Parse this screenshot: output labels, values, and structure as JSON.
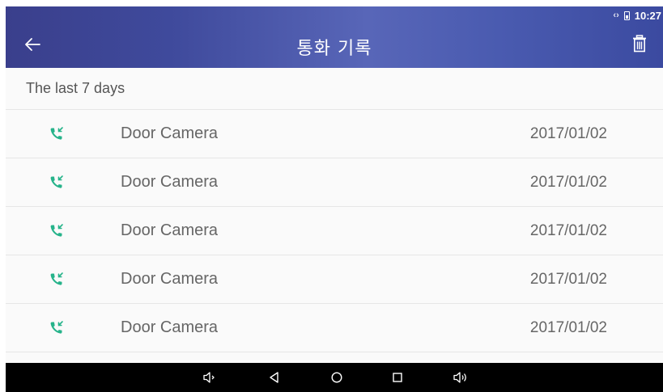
{
  "status_bar": {
    "time": "10:27",
    "sync_icon": "sync-arrows-icon",
    "battery_icon": "battery-icon"
  },
  "app_bar": {
    "title": "통화 기록",
    "back_icon": "arrow-left-icon",
    "delete_icon": "trash-icon"
  },
  "section": {
    "header": "The last 7 days"
  },
  "call_log": [
    {
      "icon": "incoming-call-icon",
      "name": "Door Camera",
      "date": "2017/01/02"
    },
    {
      "icon": "incoming-call-icon",
      "name": "Door Camera",
      "date": "2017/01/02"
    },
    {
      "icon": "incoming-call-icon",
      "name": "Door Camera",
      "date": "2017/01/02"
    },
    {
      "icon": "incoming-call-icon",
      "name": "Door Camera",
      "date": "2017/01/02"
    },
    {
      "icon": "incoming-call-icon",
      "name": "Door Camera",
      "date": "2017/01/02"
    }
  ],
  "nav_bar": [
    "volume-down-icon",
    "back-triangle-icon",
    "home-circle-icon",
    "recents-square-icon",
    "volume-up-icon"
  ],
  "colors": {
    "accent_green": "#26b38a",
    "app_bar_blue": "#3f4a9c",
    "nav_bar": "#000000"
  }
}
